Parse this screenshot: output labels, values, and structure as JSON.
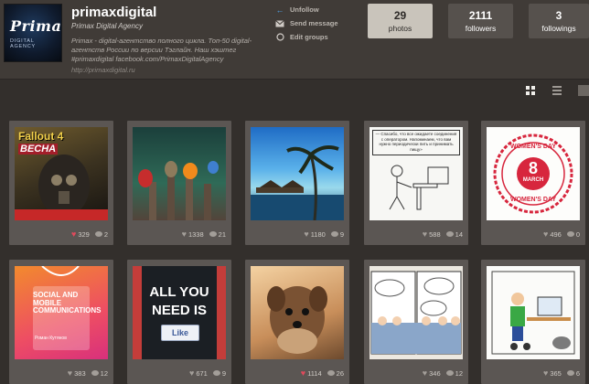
{
  "profile": {
    "logo_word": "Primax",
    "logo_sub": "DIGITAL AGENCY",
    "username": "primaxdigital",
    "full_name": "Primax Digital Agency",
    "bio": "Primax - digital-агентство полного цикла. Топ-50 digital-агентств России по версии Тэглайн. Наш хэштег #primaxdigital facebook.com/PrimaxDigitalAgency",
    "website": "http://primaxdigital.ru"
  },
  "actions": [
    {
      "label": "Unfollow",
      "icon": "arrow-left-icon"
    },
    {
      "label": "Send message",
      "icon": "envelope-icon"
    },
    {
      "label": "Edit groups",
      "icon": "circle-icon"
    }
  ],
  "stats": [
    {
      "count": "29",
      "label": "photos",
      "active": true
    },
    {
      "count": "2111",
      "label": "followers",
      "active": false
    },
    {
      "count": "3",
      "label": "followings",
      "active": false
    }
  ],
  "view_modes": [
    {
      "icon": "grid-view-icon",
      "active": true
    },
    {
      "icon": "list-view-icon",
      "active": false
    },
    {
      "icon": "large-view-icon",
      "active": false
    }
  ],
  "photos": [
    {
      "subject": "fallout",
      "title": "Fallout 4",
      "subtitle": "ВЕСНА",
      "likes": "329",
      "comments": "2",
      "liked": true
    },
    {
      "subject": "birds",
      "likes": "1338",
      "comments": "21",
      "liked": false
    },
    {
      "subject": "beach",
      "likes": "1180",
      "comments": "9",
      "liked": false
    },
    {
      "subject": "comic",
      "caption": "— Спасибо, что все ожидаете соединения с оператором. Напоминаем, что вам нужно периодически пить и принимать пищу»",
      "likes": "588",
      "comments": "14",
      "liked": false
    },
    {
      "subject": "stamp",
      "line1": "WOMEN'S DAY",
      "big": "8",
      "month": "MARCH",
      "line2": "WOMEN'S DAY",
      "likes": "496",
      "comments": "0",
      "liked": false
    },
    {
      "subject": "badge",
      "text": "SOCIAL AND MOBILE COMMUNICATIONS",
      "name": "Роман Кутянов",
      "likes": "383",
      "comments": "12",
      "liked": false
    },
    {
      "subject": "love",
      "line1": "ALL YOU",
      "line2": "NEED IS",
      "like_label": "Like",
      "likes": "671",
      "comments": "9",
      "liked": false
    },
    {
      "subject": "dog",
      "likes": "1114",
      "comments": "26",
      "liked": true
    },
    {
      "subject": "comic2",
      "likes": "346",
      "comments": "12",
      "liked": false
    },
    {
      "subject": "office",
      "likes": "365",
      "comments": "6",
      "liked": false
    }
  ],
  "colors": {
    "background": "#332f2c",
    "header": "#403b37",
    "card": "#5b5653",
    "active_stat": "#c9c4bb",
    "liked_heart": "#e04a5c",
    "unfollow_icon": "#4fa0e8"
  }
}
